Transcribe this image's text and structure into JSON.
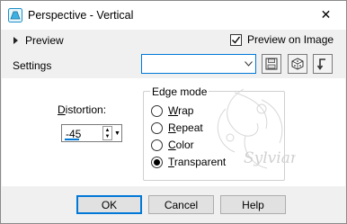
{
  "window": {
    "title": "Perspective - Vertical",
    "close_glyph": "✕"
  },
  "preview": {
    "label": "Preview",
    "on_image_label": "Preview on Image",
    "on_image_checked": true
  },
  "settings": {
    "label": "Settings",
    "value": ""
  },
  "distortion": {
    "label": "Distortion:",
    "mnemonic": "D",
    "rest": "istortion:",
    "value": "-45"
  },
  "edge_mode": {
    "title": "Edge mode",
    "options": [
      {
        "mnemonic": "W",
        "rest": "rap",
        "selected": false
      },
      {
        "mnemonic": "R",
        "rest": "epeat",
        "selected": false
      },
      {
        "mnemonic": "C",
        "rest": "olor",
        "selected": false
      },
      {
        "mnemonic": "T",
        "rest": "ransparent",
        "selected": true
      }
    ]
  },
  "buttons": {
    "ok": "OK",
    "cancel": "Cancel",
    "help": "Help"
  },
  "watermark_text": "Sylviane",
  "colors": {
    "accent": "#0078d7",
    "dialog_bg": "#f0f0f0",
    "content_bg": "#ffffff"
  },
  "icons": [
    "perspective-app-icon",
    "close-icon",
    "expand-triangle-icon",
    "checkbox-checked-icon",
    "dropdown-arrow-icon",
    "save-preset-icon",
    "randomize-icon",
    "reset-icon",
    "spin-up-icon",
    "spin-down-icon"
  ]
}
